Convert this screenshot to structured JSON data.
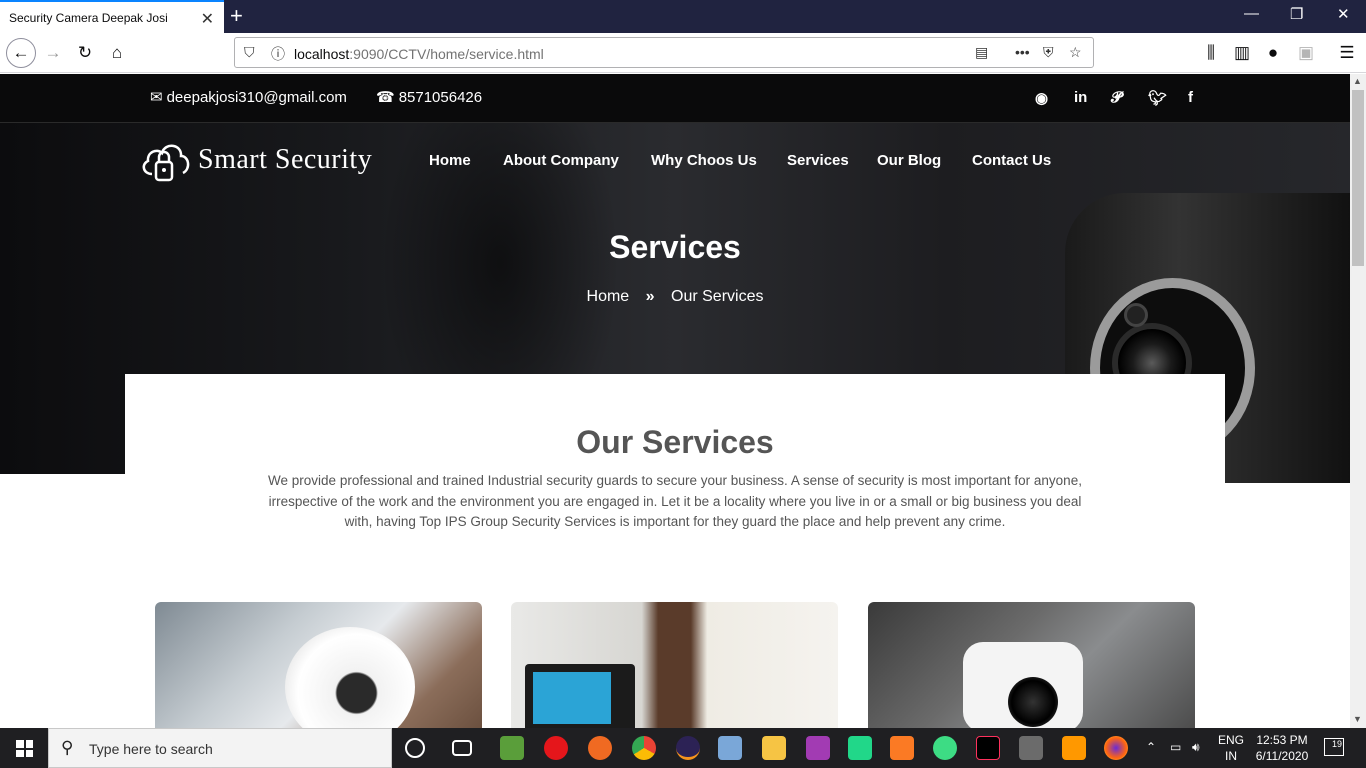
{
  "browser": {
    "tab_title": "Security Camera Deepak Josi",
    "url_host": "localhost",
    "url_rest": ":9090/CCTV/home/service.html",
    "icons": [
      "back-icon",
      "forward-icon",
      "reload-icon",
      "home-icon",
      "shield-icon",
      "info-icon",
      "reader-icon",
      "more-icon",
      "pocket-icon",
      "bookmark-star-icon",
      "library-icon",
      "sidebar-icon",
      "account-icon",
      "extension-icon",
      "menu-icon"
    ]
  },
  "site": {
    "email": "deepakjosi310@gmail.com",
    "phone": "8571056426",
    "social": [
      "github-icon",
      "linkedin-icon",
      "pinterest-icon",
      "twitter-icon",
      "facebook-icon"
    ],
    "logo_text": "Smart Security",
    "menu": [
      "Home",
      "About Company",
      "Why Choos Us",
      "Services",
      "Our Blog",
      "Contact Us"
    ],
    "hero_title": "Services",
    "breadcrumb": {
      "home": "Home",
      "sep": "»",
      "current": "Our Services"
    },
    "section_title": "Our Services",
    "section_desc": "We provide professional and trained Industrial security guards to secure your business. A sense of security is most important for anyone, irrespective of the work and the environment you are engaged in. Let it be a locality where you live in or a small or big business you deal with, having Top IPS Group Security Services is important for they guard the place and help prevent any crime."
  },
  "taskbar": {
    "search_placeholder": "Type here to search",
    "lang_1": "ENG",
    "lang_2": "IN",
    "time": "12:53 PM",
    "date": "6/11/2020",
    "notif_count": "19",
    "apps": [
      "task-view-icon",
      "cortana-icon",
      "notepad-icon",
      "opera-icon",
      "app-icon",
      "chrome-icon",
      "eclipse-icon",
      "virtualbox-icon",
      "file-explorer-icon",
      "app-icon-2",
      "pycharm-icon",
      "xampp-icon",
      "android-studio-icon",
      "intellij-icon",
      "photo-icon",
      "sublime-icon",
      "firefox-icon"
    ]
  }
}
